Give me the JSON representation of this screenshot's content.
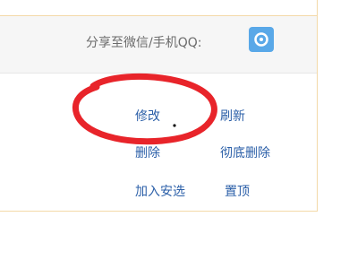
{
  "share": {
    "label": "分享至微信/手机QQ:",
    "icon": "share-icon"
  },
  "actions": {
    "edit": "修改",
    "refresh": "刷新",
    "delete": "删除",
    "purge": "彻底删除",
    "featured": "加入安选",
    "pin": "置顶"
  },
  "colors": {
    "link": "#2b5fa8",
    "annotation": "#e8242a",
    "share_button": "#59a8e8"
  }
}
